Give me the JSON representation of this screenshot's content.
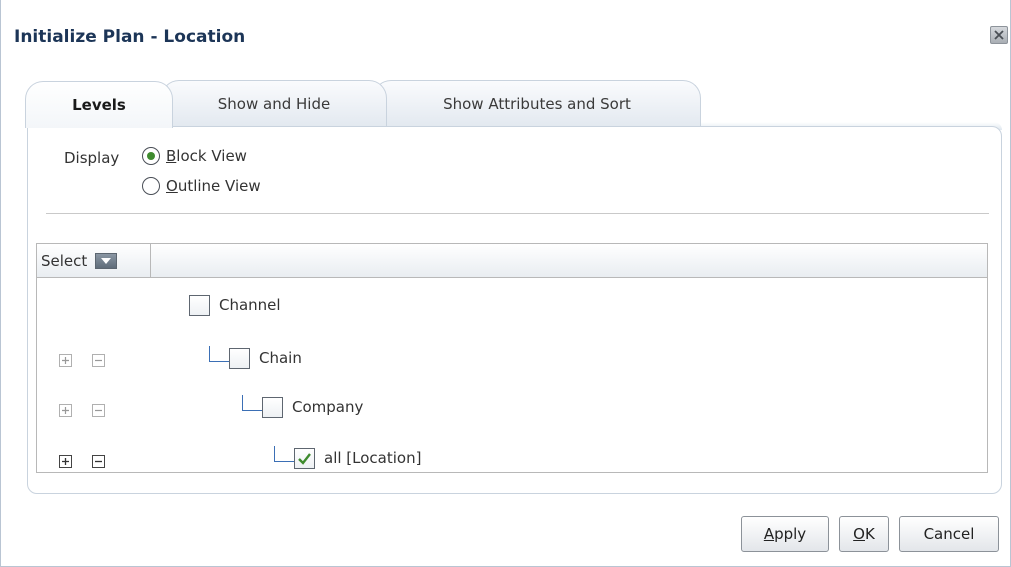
{
  "dialog": {
    "title": "Initialize Plan - Location",
    "close_icon": "close-icon"
  },
  "tabs": [
    {
      "label": "Levels",
      "active": true
    },
    {
      "label": "Show and Hide",
      "active": false
    },
    {
      "label": "Show Attributes and Sort",
      "active": false
    }
  ],
  "display": {
    "label": "Display",
    "options": [
      {
        "label_first": "B",
        "label_rest": "lock View",
        "selected": true
      },
      {
        "label_first": "O",
        "label_rest": "utline View",
        "selected": false
      }
    ]
  },
  "table": {
    "select_label": "Select",
    "rows": [
      {
        "label": "Channel",
        "checked": false
      },
      {
        "label": "Chain",
        "checked": false
      },
      {
        "label": "Company",
        "checked": false
      },
      {
        "label": "all [Location]",
        "checked": true
      }
    ]
  },
  "buttons": {
    "apply_first": "A",
    "apply_rest": "pply",
    "ok_first": "O",
    "ok_rest": "K",
    "cancel": "Cancel"
  },
  "colors": {
    "title": "#1c3557",
    "connector": "#3b6fb5",
    "radio_dot": "#3e8b2e",
    "check": "#3e8b2e"
  }
}
